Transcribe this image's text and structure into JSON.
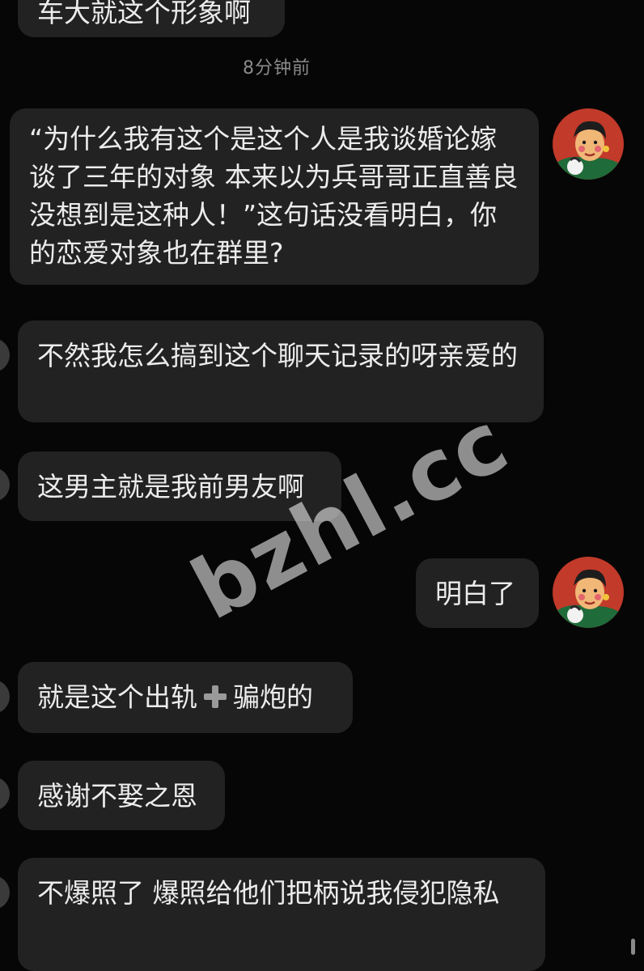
{
  "chat": {
    "messages": [
      {
        "id": "m0",
        "side": "left",
        "text": "车大就这个形象啊"
      },
      {
        "id": "m1",
        "side": "right",
        "text": "“为什么我有这个是这个人是我谈婚论嫁 谈了三年的对象 本来以为兵哥哥正直善良 没想到是这种人！”这句话没看明白，你的恋爱对象也在群里?"
      },
      {
        "id": "m2",
        "side": "left",
        "text": "不然我怎么搞到这个聊天记录的呀亲爱的"
      },
      {
        "id": "m3",
        "side": "left",
        "text": "这男主就是我前男友啊"
      },
      {
        "id": "m4",
        "side": "right",
        "text": "明白了"
      },
      {
        "id": "m5",
        "side": "left",
        "text_before": "就是这个出轨",
        "icon": "plus-emoji-icon",
        "text_after": "骗炮的"
      },
      {
        "id": "m6",
        "side": "left",
        "text": "感谢不娶之恩"
      },
      {
        "id": "m7",
        "side": "left",
        "text": "不爆照了 爆照给他们把柄说我侵犯隐私"
      }
    ],
    "timestamp": "8分钟前"
  },
  "watermark": "bzhl.cc",
  "colors": {
    "background": "#060606",
    "bubble": "#222222",
    "text": "#ececec",
    "timestamp": "#8a8a8a"
  }
}
